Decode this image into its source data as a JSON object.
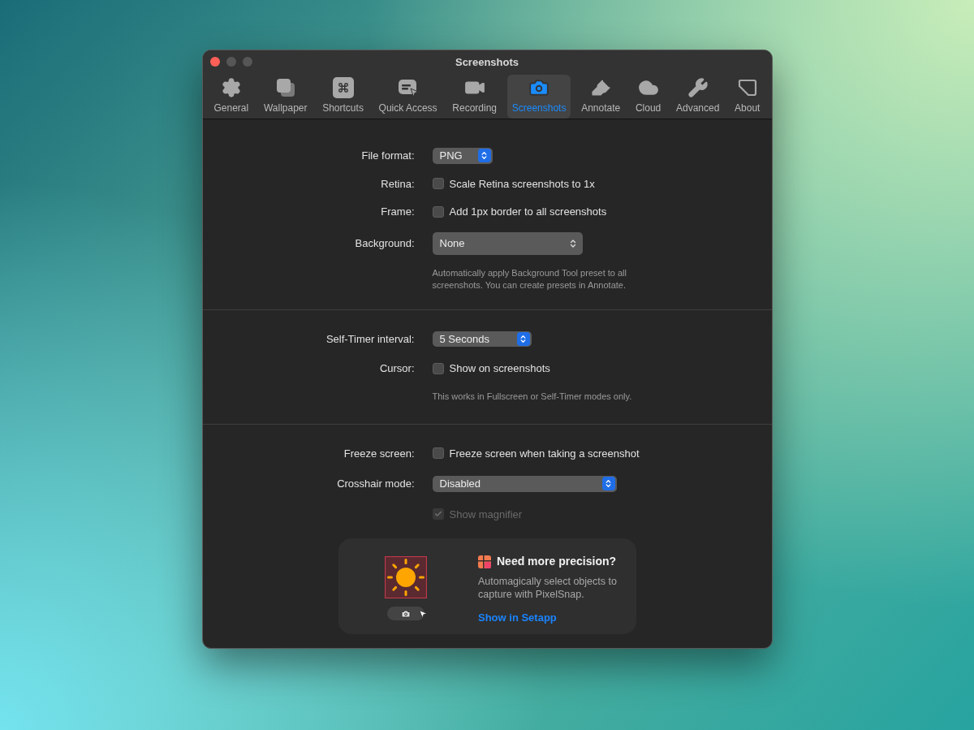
{
  "window": {
    "title": "Screenshots"
  },
  "tabs": [
    {
      "label": "General",
      "selected": false
    },
    {
      "label": "Wallpaper",
      "selected": false
    },
    {
      "label": "Shortcuts",
      "selected": false
    },
    {
      "label": "Quick Access",
      "selected": false
    },
    {
      "label": "Recording",
      "selected": false
    },
    {
      "label": "Screenshots",
      "selected": true
    },
    {
      "label": "Annotate",
      "selected": false
    },
    {
      "label": "Cloud",
      "selected": false
    },
    {
      "label": "Advanced",
      "selected": false
    },
    {
      "label": "About",
      "selected": false
    }
  ],
  "sections": [
    {
      "rows": [
        {
          "kind": "popup",
          "label": "File format:",
          "value": "PNG",
          "highlighted": true
        },
        {
          "kind": "checkbox",
          "label": "Retina:",
          "text": "Scale Retina screenshots to 1x",
          "checked": false,
          "disabled": false
        },
        {
          "kind": "checkbox",
          "label": "Frame:",
          "text": "Add 1px border to all screenshots",
          "checked": false,
          "disabled": false
        },
        {
          "kind": "popup",
          "label": "Background:",
          "value": "None",
          "highlighted": false
        },
        {
          "kind": "note",
          "text": "Automatically apply Background Tool preset to all screenshots. You can create presets in Annotate."
        }
      ]
    },
    {
      "rows": [
        {
          "kind": "popup",
          "label": "Self-Timer interval:",
          "value": "5 Seconds",
          "highlighted": true
        },
        {
          "kind": "checkbox",
          "label": "Cursor:",
          "text": "Show on screenshots",
          "checked": false,
          "disabled": false
        },
        {
          "kind": "note",
          "text": "This works in Fullscreen or Self-Timer modes only."
        }
      ]
    },
    {
      "rows": [
        {
          "kind": "checkbox",
          "label": "Freeze screen:",
          "text": "Freeze screen when taking a screenshot",
          "checked": false,
          "disabled": false
        },
        {
          "kind": "popup",
          "label": "Crosshair mode:",
          "value": "Disabled",
          "highlighted": true
        },
        {
          "kind": "checkbox",
          "text": "Show magnifier",
          "checked": true,
          "disabled": true
        }
      ]
    }
  ],
  "promo": {
    "title": "Need more precision?",
    "description": "Automagically select objects to capture with PixelSnap.",
    "link": "Show in Setapp"
  }
}
